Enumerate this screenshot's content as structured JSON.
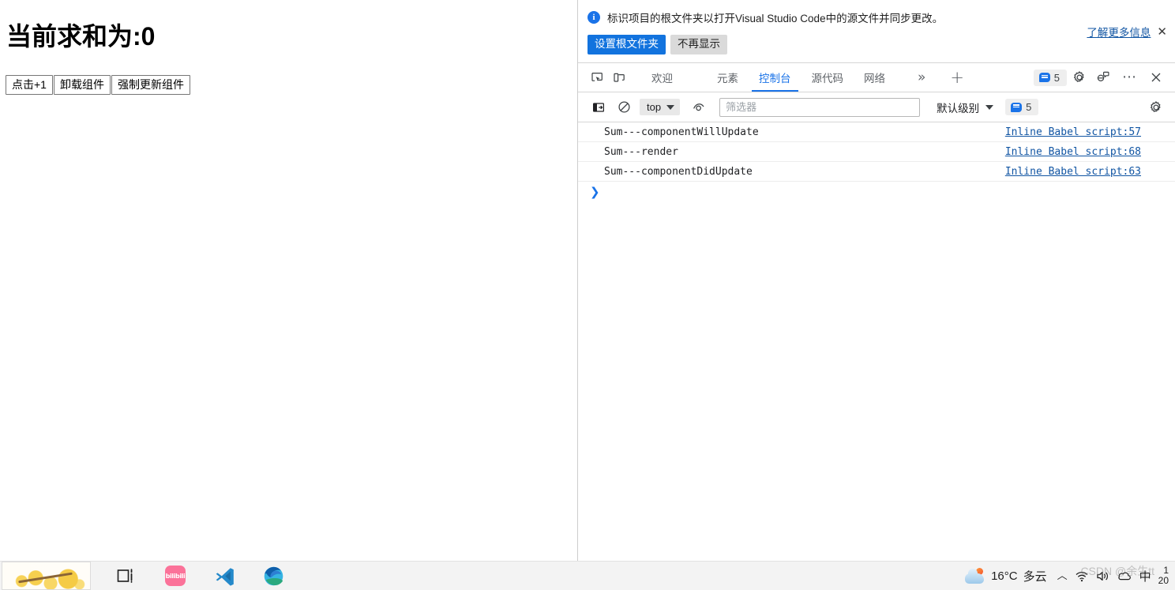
{
  "page": {
    "title": "当前求和为:0",
    "buttons": [
      {
        "label": "点击+1"
      },
      {
        "label": "卸载组件"
      },
      {
        "label": "强制更新组件"
      }
    ]
  },
  "banner": {
    "icon": "info-icon",
    "info_char": "i",
    "message": "标识项目的根文件夹以打开Visual Studio Code中的源文件并同步更改。",
    "primary_button": "设置根文件夹",
    "secondary_button": "不再显示",
    "link": "了解更多信息",
    "close": "✕",
    "primary_color": "#1273de"
  },
  "devtools": {
    "inspect_icon": "inspect-element-icon",
    "device_icon": "device-toolbar-icon",
    "tabs": [
      {
        "label": "欢迎",
        "active": false
      },
      {
        "label": "元素",
        "active": false
      },
      {
        "label": "控制台",
        "active": true
      },
      {
        "label": "源代码",
        "active": false
      },
      {
        "label": "网络",
        "active": false
      }
    ],
    "more_tabs": "»",
    "add_tab": "+",
    "message_count": "5",
    "gear_icon": "settings-gear-icon",
    "feedback_icon": "feedback-icon",
    "more_options": "⋯",
    "close": "✕",
    "active_tab_color": "#1a73e8"
  },
  "console_toolbar": {
    "sidebar_icon": "console-sidebar-icon",
    "clear_icon": "clear-console-icon",
    "context": "top",
    "live_expression_icon": "live-expression-eye-icon",
    "filter_placeholder": "筛选器",
    "filter_value": "",
    "level": "默认级别",
    "issues_count": "5",
    "settings_icon": "console-settings-gear-icon"
  },
  "console_messages": [
    {
      "text": "Sum---componentWillUpdate",
      "source": "Inline Babel script:57"
    },
    {
      "text": "Sum---render",
      "source": "Inline Babel script:68"
    },
    {
      "text": "Sum---componentDidUpdate",
      "source": "Inline Babel script:63"
    }
  ],
  "console_prompt": {
    "chevron": "❯"
  },
  "taskbar": {
    "thumbnail": "wallpaper-thumbnail",
    "icons": [
      {
        "name": "task-view-icon"
      },
      {
        "name": "bilibili-icon",
        "label": "bilibili"
      },
      {
        "name": "vscode-icon"
      },
      {
        "name": "edge-icon"
      }
    ],
    "weather": {
      "icon": "partly-cloudy-icon",
      "temperature": "16°C",
      "condition": "多云"
    },
    "tray": {
      "chevron_up": "︿",
      "network_icon": "wifi-icon",
      "volume_icon": "volume-icon",
      "onedrive_icon": "onedrive-icon",
      "ime": "中"
    },
    "clock": {
      "time": "1",
      "date": "20"
    }
  },
  "watermark": "CSDN @余生tt"
}
